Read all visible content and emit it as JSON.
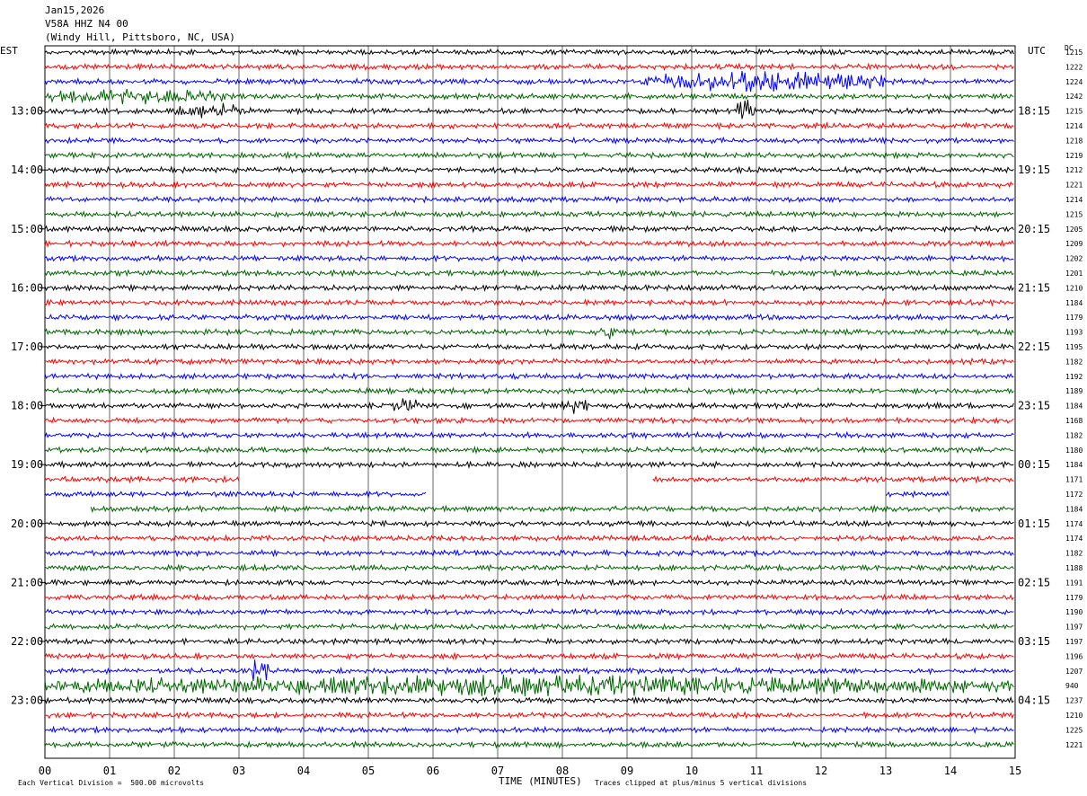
{
  "header": {
    "date": "Jan15,2026",
    "station": "V58A HHZ N4 00",
    "location": "(Windy Hill, Pittsboro, NC, USA)"
  },
  "left_tz": "EST",
  "right_tz": "UTC",
  "dc_label": "DC",
  "footer": {
    "scale_note": "Each Vertical Division =  500.00 microvolts",
    "xlabel": "TIME (MINUTES)",
    "clip_note": "Traces clipped at plus/minus 5 vertical divisions"
  },
  "chart_data": {
    "type": "line",
    "title": "V58A HHZ N4 00",
    "xlabel": "TIME (MINUTES)",
    "xlim": [
      0,
      15
    ],
    "x_ticks": [
      "00",
      "01",
      "02",
      "03",
      "04",
      "05",
      "06",
      "07",
      "08",
      "09",
      "10",
      "11",
      "12",
      "13",
      "14",
      "15"
    ],
    "row_colors": [
      "#000000",
      "#ff0000",
      "#0000ff",
      "#006400"
    ],
    "left_hour_labels": [
      "13:00",
      "14:00",
      "15:00",
      "16:00",
      "17:00",
      "18:00",
      "19:00",
      "20:00",
      "21:00",
      "22:00",
      "23:00"
    ],
    "right_hour_labels": [
      "18:15",
      "19:15",
      "20:15",
      "21:15",
      "22:15",
      "23:15",
      "00:15",
      "01:15",
      "02:15",
      "03:15",
      "04:15"
    ],
    "dc_offsets": [
      1215,
      1222,
      1224,
      1242,
      1215,
      1214,
      1218,
      1219,
      1212,
      1221,
      1214,
      1215,
      1205,
      1209,
      1202,
      1201,
      1210,
      1184,
      1179,
      1193,
      1195,
      1182,
      1192,
      1189,
      1184,
      1168,
      1182,
      1180,
      1184,
      1171,
      1172,
      1184,
      1174,
      1174,
      1182,
      1188,
      1191,
      1179,
      1190,
      1197,
      1197,
      1196,
      1207,
      940,
      1237,
      1210,
      1225,
      1221
    ],
    "events": [
      {
        "row": 2,
        "start_min": 9.2,
        "end_min": 13.0,
        "amp": 3
      },
      {
        "row": 2,
        "start_min": 10.7,
        "end_min": 11.0,
        "amp": 5
      },
      {
        "row": 3,
        "start_min": 0.0,
        "end_min": 2.8,
        "amp": 2
      },
      {
        "row": 4,
        "start_min": 2.0,
        "end_min": 3.2,
        "amp": 2
      },
      {
        "row": 4,
        "start_min": 10.7,
        "end_min": 11.0,
        "amp": 4
      },
      {
        "row": 19,
        "start_min": 8.5,
        "end_min": 8.9,
        "amp": 2
      },
      {
        "row": 24,
        "start_min": 5.4,
        "end_min": 5.8,
        "amp": 2
      },
      {
        "row": 24,
        "start_min": 8.0,
        "end_min": 8.4,
        "amp": 2
      },
      {
        "row": 42,
        "start_min": 3.1,
        "end_min": 3.5,
        "amp": 4
      },
      {
        "row": 43,
        "start_min": 0.0,
        "end_min": 15.0,
        "amp": 3
      }
    ],
    "gaps": [
      {
        "row": 29,
        "start_min": 3.0,
        "end_min": 9.4
      },
      {
        "row": 30,
        "start_min": 5.9,
        "end_min": 13.0
      },
      {
        "row": 30,
        "start_min": 14.0,
        "end_min": 15.0
      },
      {
        "row": 31,
        "start_min": 0.0,
        "end_min": 0.7
      }
    ]
  }
}
